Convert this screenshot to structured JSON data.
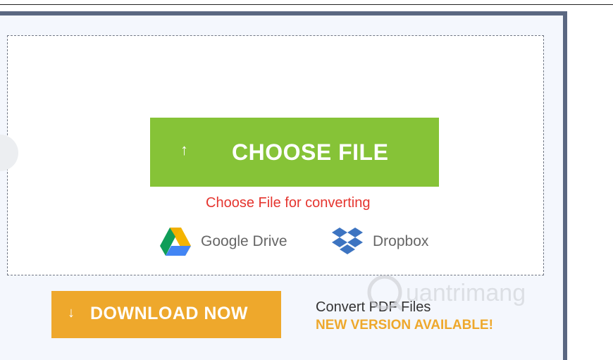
{
  "upload": {
    "choose_label": "CHOOSE FILE",
    "hint": "Choose File for converting"
  },
  "sources": [
    {
      "name": "Google Drive",
      "icon": "google-drive-icon"
    },
    {
      "name": "Dropbox",
      "icon": "dropbox-icon"
    }
  ],
  "download": {
    "label": "DOWNLOAD NOW",
    "icon": "download-arrow-icon"
  },
  "promo": {
    "title": "Convert PDF Files",
    "subtitle": "NEW VERSION AVAILABLE!"
  },
  "watermark": "Quantrimang",
  "colors": {
    "choose_button": "#86c337",
    "hint_text": "#e5352f",
    "download_button": "#eea82c",
    "panel_border": "#5a6781",
    "panel_background": "#f4f7fd"
  }
}
